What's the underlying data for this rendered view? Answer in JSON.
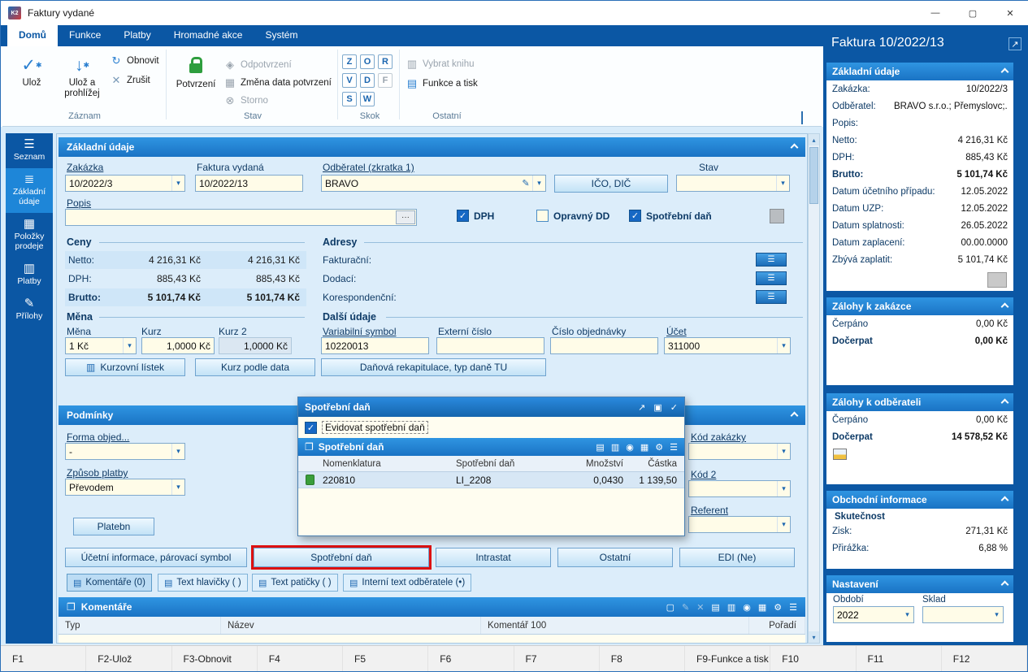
{
  "window": {
    "title": "Faktury vydané"
  },
  "titlebar": {
    "minimize": "—",
    "maximize": "▢",
    "close": "✕"
  },
  "icons": {
    "app": "K2",
    "check": "✓",
    "star": "✱",
    "down_arrow": "↓",
    "refresh": "↻",
    "cancel": "✕",
    "diamond": "◈",
    "calendar": "▦",
    "storno": "⊗",
    "book": "▥",
    "printer": "▤",
    "chart": "▥",
    "binoculars": "◉",
    "columns": "▦",
    "gear": "⚙",
    "menu": "☰",
    "list": "≣",
    "grid": "▦",
    "payments": "▥",
    "attachment": "✎",
    "external": "↗",
    "pin": "▣",
    "dropdown": "▾",
    "ellipsis": "···",
    "open_book": "❐",
    "new_doc": "▢",
    "sign": "✎",
    "up": "▴",
    "down": "▾"
  },
  "ribbon": {
    "tabs": [
      {
        "label": "Domů"
      },
      {
        "label": "Funkce"
      },
      {
        "label": "Platby"
      },
      {
        "label": "Hromadné akce"
      },
      {
        "label": "Systém"
      }
    ],
    "zaznam": {
      "label": "Záznam",
      "uloz": "Ulož",
      "uloz_prohlizej": "Ulož a prohlížej",
      "obnovit": "Obnovit",
      "zrusit": "Zrušit"
    },
    "stav": {
      "label": "Stav",
      "potvrzeni": "Potvrzení",
      "odpotvrzeni": "Odpotvrzení",
      "zmena": "Změna data potvrzení",
      "storno": "Storno"
    },
    "skok": {
      "label": "Skok",
      "keys": [
        "Z",
        "O",
        "R",
        "V",
        "D",
        "F",
        "S",
        "W"
      ]
    },
    "ostatni": {
      "label": "Ostatní",
      "vybrat_knihu": "Vybrat knihu",
      "funkce_tisk": "Funkce a tisk"
    }
  },
  "sidebar": {
    "items": [
      {
        "label": "Seznam"
      },
      {
        "label": "Základní údaje"
      },
      {
        "label": "Položky prodeje"
      },
      {
        "label": "Platby"
      },
      {
        "label": "Přílohy"
      }
    ]
  },
  "form": {
    "section_title": "Základní údaje",
    "zakazka_label": "Zakázka",
    "zakazka_value": "10/2022/3",
    "faktura_label": "Faktura vydaná",
    "faktura_value": "10/2022/13",
    "odberatel_label": "Odběratel (zkratka 1)",
    "odberatel_value": "BRAVO",
    "ico_dic": "IČO, DIČ",
    "stav_label": "Stav",
    "stav_value": "",
    "popis_label": "Popis",
    "popis_value": "",
    "checkbox_dph": "DPH",
    "checkbox_opravny": "Opravný DD",
    "checkbox_spotrebni": "Spotřební daň",
    "ceny": {
      "title": "Ceny",
      "rows": [
        {
          "label": "Netto:",
          "v1": "4 216,31 Kč",
          "v2": "4 216,31 Kč"
        },
        {
          "label": "DPH:",
          "v1": "885,43 Kč",
          "v2": "885,43 Kč"
        },
        {
          "label": "Brutto:",
          "v1": "5 101,74 Kč",
          "v2": "5 101,74 Kč"
        }
      ]
    },
    "adresy": {
      "title": "Adresy",
      "rows": [
        "Fakturační:",
        "Dodací:",
        "Korespondenční:"
      ]
    },
    "mena": {
      "title": "Měna",
      "mena_label": "Měna",
      "mena_value": "1 Kč",
      "kurz_label": "Kurz",
      "kurz_value": "1,0000 Kč",
      "kurz2_label": "Kurz 2",
      "kurz2_value": "1,0000 Kč"
    },
    "dalsi": {
      "title": "Další údaje",
      "varsym_label": "Variabilní symbol",
      "varsym_value": "10220013",
      "externi_label": "Externí číslo",
      "externi_value": "",
      "cislo_obj_label": "Číslo objednávky",
      "cislo_obj_value": "",
      "ucet_label": "Účet",
      "ucet_value": "311000"
    },
    "kurzovni_listek": "Kurzovní lístek",
    "kurz_podle_data": "Kurz podle data",
    "danova_rekapitulace": "Daňová rekapitulace, typ daně TU",
    "podminky": {
      "title": "Podmínky",
      "forma_label": "Forma objed...",
      "forma_value": "-",
      "zpusob_label": "Způsob platby",
      "zpusob_value": "Převodem",
      "platebni": "Platebn"
    },
    "kod_zakazky_label": "Kód zakázky",
    "kod2_label": "Kód 2",
    "referent_label": "Referent",
    "bottom_buttons": [
      "Účetní informace, párovací symbol",
      "Spotřební daň",
      "Intrastat",
      "Ostatní",
      "EDI (Ne)"
    ],
    "tabs": [
      "Komentáře (0)",
      "Text hlavičky ( )",
      "Text patičky ( )",
      "Interní text odběratele (•)"
    ],
    "komentare": {
      "title": "Komentáře",
      "columns": [
        "Typ",
        "Název",
        "Komentář 100",
        "Pořadí"
      ]
    }
  },
  "popup": {
    "title": "Spotřební daň",
    "checkbox": "Evidovat spotřební daň",
    "checked": true,
    "grid_title": "Spotřební daň",
    "columns": [
      "Nomenklatura",
      "Spotřební daň",
      "Množství",
      "Částka"
    ],
    "row": {
      "nomenklatura": "220810",
      "spotrebni_dan": "LI_2208",
      "mnozstvi": "0,0430",
      "castka": "1 139,50"
    }
  },
  "right_panel": {
    "title": "Faktura 10/2022/13",
    "zakladni": {
      "title": "Základní údaje",
      "rows": [
        {
          "label": "Zakázka:",
          "value": "10/2022/3"
        },
        {
          "label": "Odběratel:",
          "value": "BRAVO s.r.o.; Přemyslovc;..."
        },
        {
          "label": "Popis:",
          "value": ""
        },
        {
          "label": "Netto:",
          "value": "4 216,31 Kč"
        },
        {
          "label": "DPH:",
          "value": "885,43 Kč"
        },
        {
          "label": "Brutto:",
          "value": "5 101,74 Kč"
        },
        {
          "label": "Datum účetního případu:",
          "value": "12.05.2022"
        },
        {
          "label": "Datum UZP:",
          "value": "12.05.2022"
        },
        {
          "label": "Datum splatnosti:",
          "value": "26.05.2022"
        },
        {
          "label": "Datum zaplacení:",
          "value": "00.00.0000"
        },
        {
          "label": "Zbývá zaplatit:",
          "value": "5 101,74 Kč"
        }
      ]
    },
    "zalohy_zakazka": {
      "title": "Zálohy k zakázce",
      "rows": [
        {
          "label": "Čerpáno",
          "value": "0,00 Kč"
        },
        {
          "label": "Dočerpat",
          "value": "0,00 Kč"
        }
      ]
    },
    "zalohy_odberatel": {
      "title": "Zálohy k odběrateli",
      "rows": [
        {
          "label": "Čerpáno",
          "value": "0,00 Kč"
        },
        {
          "label": "Dočerpat",
          "value": "14 578,52 Kč"
        }
      ]
    },
    "obchodni": {
      "title": "Obchodní informace",
      "subtitle": "Skutečnost",
      "rows": [
        {
          "label": "Zisk:",
          "value": "271,31 Kč"
        },
        {
          "label": "Přirážka:",
          "value": "6,88 %"
        }
      ]
    },
    "nastaveni": {
      "title": "Nastavení",
      "obdobi_label": "Období",
      "obdobi_value": "2022",
      "sklad_label": "Sklad",
      "sklad_value": ""
    }
  },
  "statusbar": {
    "keys": [
      "F1",
      "F2-Ulož",
      "F3-Obnovit",
      "F4",
      "F5",
      "F6",
      "F7",
      "F8",
      "F9-Funkce a tisk",
      "F10",
      "F11",
      "F12"
    ]
  }
}
